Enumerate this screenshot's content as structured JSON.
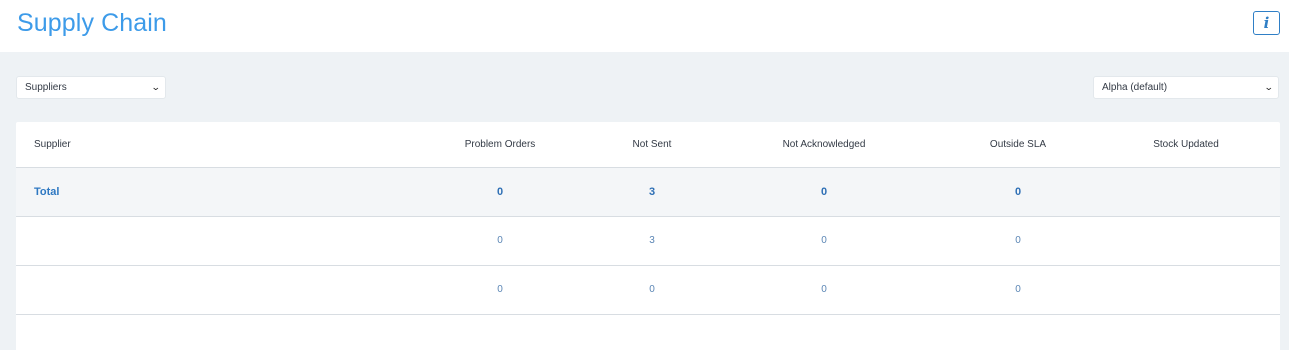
{
  "header": {
    "title": "Supply Chain",
    "info_label": "i"
  },
  "filters": {
    "view_select": {
      "value": "Suppliers"
    },
    "sort_select": {
      "value": "Alpha (default)"
    }
  },
  "table": {
    "columns": [
      "Supplier",
      "Problem Orders",
      "Not Sent",
      "Not Acknowledged",
      "Outside SLA",
      "Stock Updated"
    ],
    "total": {
      "label": "Total",
      "problem_orders": "0",
      "not_sent": "3",
      "not_acknowledged": "0",
      "outside_sla": "0",
      "stock_updated": ""
    },
    "rows": [
      {
        "supplier": "",
        "problem_orders": "0",
        "not_sent": "3",
        "not_acknowledged": "0",
        "outside_sla": "0",
        "stock_updated": ""
      },
      {
        "supplier": "",
        "problem_orders": "0",
        "not_sent": "0",
        "not_acknowledged": "0",
        "outside_sla": "0",
        "stock_updated": ""
      }
    ]
  },
  "icons": {
    "info": "info-icon",
    "chevron": "chevron-down-icon"
  },
  "colors": {
    "accent": "#3d9be9",
    "link": "#2e78c2",
    "background": "#eef2f5"
  }
}
